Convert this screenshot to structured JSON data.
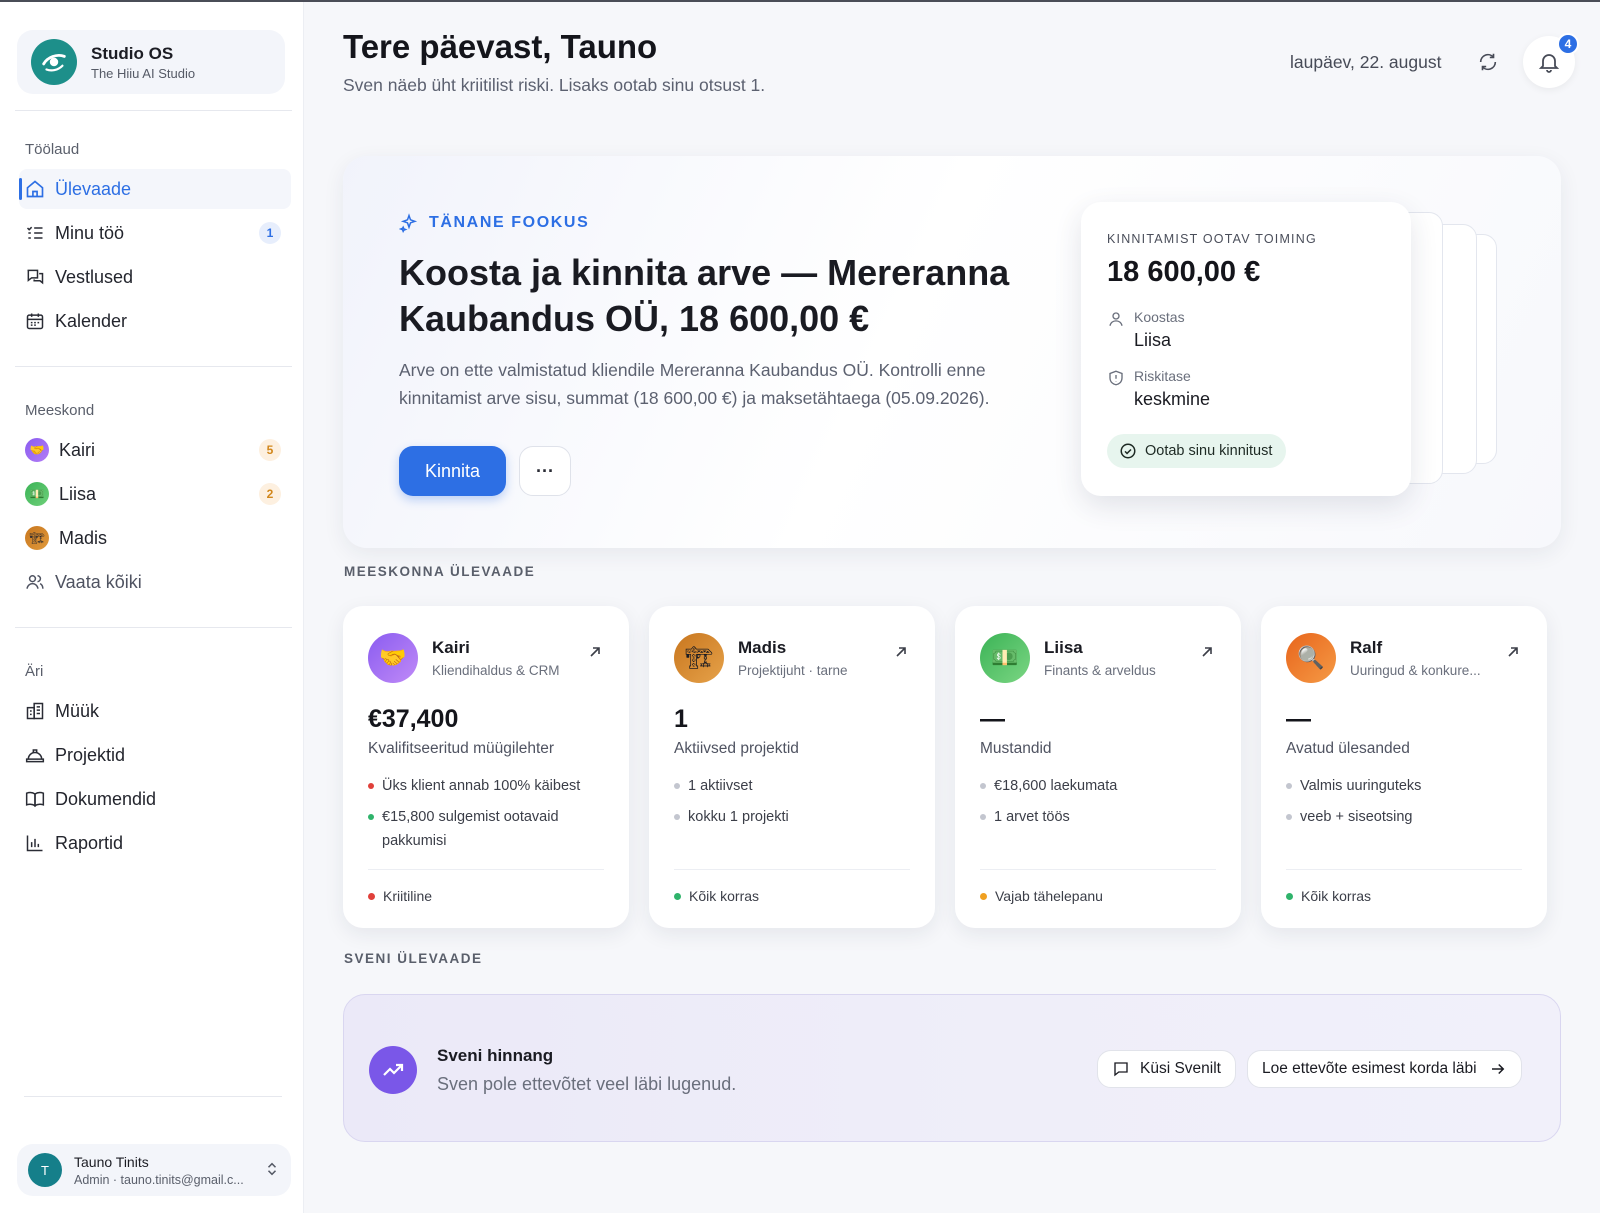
{
  "sidebar": {
    "brand": {
      "name": "Studio OS",
      "subtitle": "The Hiiu AI Studio"
    },
    "sections": {
      "workspace": {
        "title": "Töölaud",
        "items": [
          {
            "label": "Ülevaade",
            "icon": "home-icon",
            "active": true
          },
          {
            "label": "Minu töö",
            "icon": "list-icon",
            "badge": "1"
          },
          {
            "label": "Vestlused",
            "icon": "chat-icon"
          },
          {
            "label": "Kalender",
            "icon": "calendar-icon"
          }
        ]
      },
      "team": {
        "title": "Meeskond",
        "items": [
          {
            "label": "Kairi",
            "icon": "handshake-avatar",
            "badge": "5"
          },
          {
            "label": "Liisa",
            "icon": "money-avatar",
            "badge": "2"
          },
          {
            "label": "Madis",
            "icon": "crane-avatar"
          },
          {
            "label": "Vaata kõiki",
            "icon": "users-icon"
          }
        ]
      },
      "business": {
        "title": "Äri",
        "items": [
          {
            "label": "Müük",
            "icon": "building-icon"
          },
          {
            "label": "Projektid",
            "icon": "hardhat-icon"
          },
          {
            "label": "Dokumendid",
            "icon": "book-icon"
          },
          {
            "label": "Raportid",
            "icon": "barchart-icon"
          }
        ]
      }
    },
    "user": {
      "initial": "T",
      "name": "Tauno Tinits",
      "subtitle": "Admin · tauno.tinits@gmail.c..."
    }
  },
  "header": {
    "greeting": "Tere päevast, Tauno",
    "subtitle": "Sven näeb üht kriitilist riski. Lisaks ootab sinu otsust 1.",
    "date": "laupäev, 22. august",
    "notifications_count": "4"
  },
  "focus": {
    "label": "TÄNANE FOOKUS",
    "title": "Koosta ja kinnita arve — Mereranna Kaubandus OÜ, 18 600,00 €",
    "description": "Arve on ette valmistatud kliendile Mereranna Kaubandus OÜ. Kontrolli enne kinnitamist arve sisu, summat (18 600,00 €) ja maksetähtaega (05.09.2026).",
    "primary_button": "Kinnita",
    "more_button": "···",
    "pending": {
      "title": "KINNITAMIST OOTAV TOIMING",
      "amount": "18 600,00 €",
      "created_by_label": "Koostas",
      "created_by": "Liisa",
      "risk_label": "Riskitase",
      "risk": "keskmine",
      "status": "Ootab sinu kinnitust"
    }
  },
  "team_overview": {
    "title": "MEESKONNA ÜLEVAADE",
    "cards": [
      {
        "name": "Kairi",
        "role": "Kliendihaldus & CRM",
        "avatar": "handshake",
        "metric": "€37,400",
        "metric_label": "Kvalifitseeritud müügilehter",
        "bullets": [
          "Üks klient annab 100% käibest",
          "€15,800 sulgemist ootavaid pakkumisi"
        ],
        "bullet_colors": [
          "#e0403a",
          "#2fb36b"
        ],
        "status": "Kriitiline",
        "status_color": "#e0403a"
      },
      {
        "name": "Madis",
        "role": "Projektijuht · tarne",
        "avatar": "crane",
        "metric": "1",
        "metric_label": "Aktiivsed projektid",
        "bullets": [
          "1 aktiivset",
          "kokku 1 projekti"
        ],
        "bullet_colors": [
          "#c3c6cf",
          "#c3c6cf"
        ],
        "status": "Kõik korras",
        "status_color": "#2fb36b"
      },
      {
        "name": "Liisa",
        "role": "Finants & arveldus",
        "avatar": "money",
        "metric": "—",
        "metric_label": "Mustandid",
        "bullets": [
          "€18,600 laekumata",
          "1 arvet töös"
        ],
        "bullet_colors": [
          "#c3c6cf",
          "#c3c6cf"
        ],
        "status": "Vajab tähelepanu",
        "status_color": "#f0a020"
      },
      {
        "name": "Ralf",
        "role": "Uuringud & konkure...",
        "avatar": "magnifier",
        "metric": "—",
        "metric_label": "Avatud ülesanded",
        "bullets": [
          "Valmis uuringuteks",
          "veeb + siseotsing"
        ],
        "bullet_colors": [
          "#c3c6cf",
          "#c3c6cf"
        ],
        "status": "Kõik korras",
        "status_color": "#2fb36b"
      }
    ]
  },
  "sven": {
    "section_title": "SVENI ÜLEVAADE",
    "title": "Sveni hinnang",
    "text": "Sven pole ettevõtet veel läbi lugenud.",
    "ask_button": "Küsi Svenilt",
    "read_button": "Loe ettevõte esimest korda läbi"
  },
  "colors": {
    "accent": "#2d6fe4",
    "critical": "#e0403a",
    "ok": "#2fb36b",
    "warning": "#f0a020",
    "sven": "#7a57e8"
  }
}
